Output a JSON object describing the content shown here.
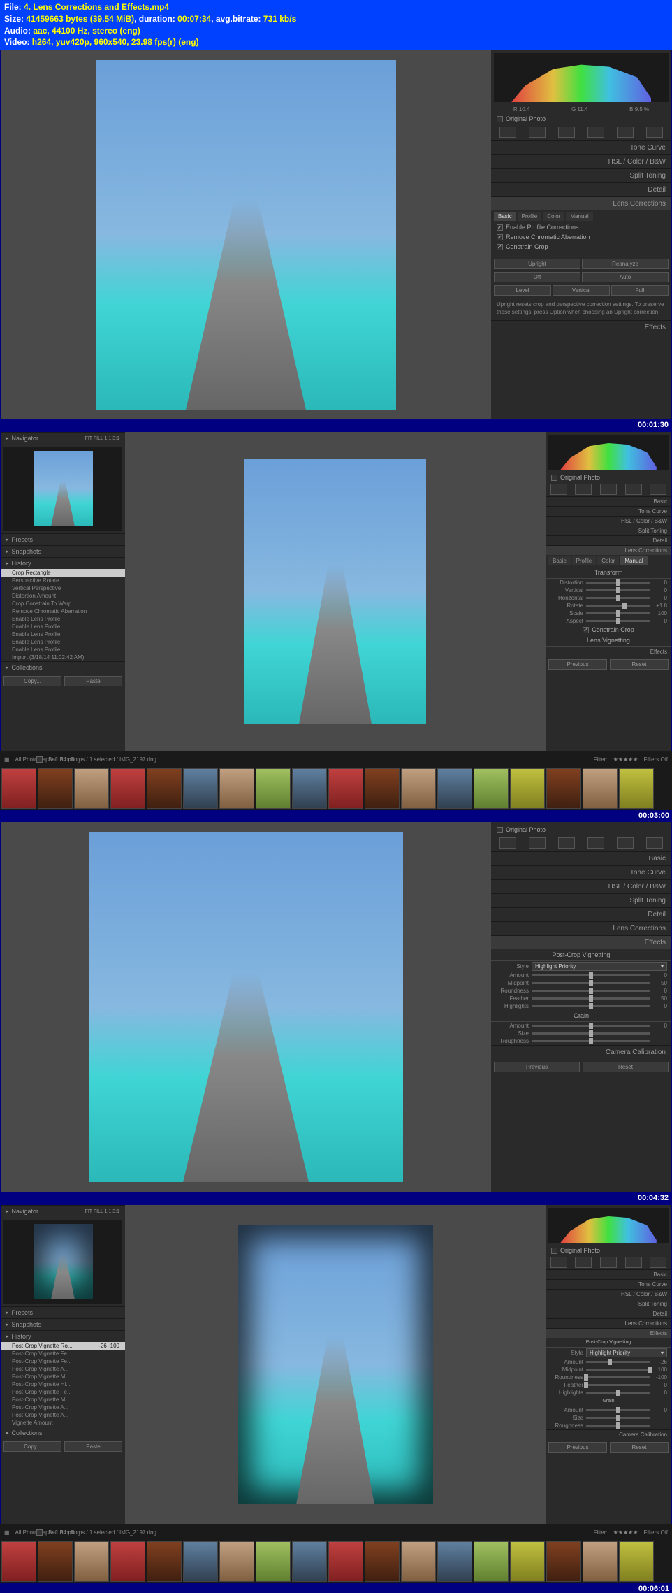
{
  "header": {
    "file_label": "File:",
    "file_value": "4. Lens Corrections and Effects.mp4",
    "size_label": "Size:",
    "size_bytes": "41459663 bytes (39.54 MiB)",
    "duration_label": "duration:",
    "duration": "00:07:34",
    "bitrate_label": "avg.bitrate:",
    "bitrate": "731 kb/s",
    "audio_label": "Audio:",
    "audio": "aac, 44100 Hz, stereo (eng)",
    "video_label": "Video:",
    "video": "h264, yuv420p, 960x540, 23.98 fps(r) (eng)"
  },
  "timestamps": [
    "00:01:30",
    "00:03:00",
    "00:04:32",
    "00:06:01"
  ],
  "panels": {
    "histogram_stats": {
      "r": "R 10.4",
      "g": "G 11.4",
      "b": "B 9.5 %"
    },
    "original_photo": "Original Photo",
    "sections": {
      "basic": "Basic",
      "tone_curve": "Tone Curve",
      "hsl": "HSL / Color / B&W",
      "split_toning": "Split Toning",
      "detail": "Detail",
      "lens_corrections": "Lens Corrections",
      "effects": "Effects",
      "camera_calibration": "Camera Calibration"
    },
    "lens_tabs": [
      "Basic",
      "Profile",
      "Color",
      "Manual"
    ],
    "lens_checks": {
      "profile": "Enable Profile Corrections",
      "chromatic": "Remove Chromatic Aberration",
      "constrain": "Constrain Crop"
    },
    "upright_btns_row1": [
      "Upright",
      "Reanalyze"
    ],
    "upright_btns_row2": [
      "Off",
      "Auto"
    ],
    "upright_btns_row3": [
      "Level",
      "Vertical",
      "Full"
    ],
    "upright_hint": "Upright resets crop and perspective correction settings. To preserve these settings, press Option when choosing an Upright correction.",
    "transform": {
      "title": "Transform",
      "rows": [
        {
          "label": "Distortion",
          "val": "0"
        },
        {
          "label": "Vertical",
          "val": "0"
        },
        {
          "label": "Horizontal",
          "val": "0"
        },
        {
          "label": "Rotate",
          "val": "+1.8"
        },
        {
          "label": "Scale",
          "val": "100"
        },
        {
          "label": "Aspect",
          "val": "0"
        }
      ],
      "constrain": "Constrain Crop",
      "lens_vignetting": "Lens Vignetting"
    },
    "effects_panel": {
      "pcv_title": "Post-Crop Vignetting",
      "style_label": "Style",
      "style_value": "Highlight Priority",
      "sliders1": [
        {
          "label": "Amount",
          "val": "0"
        },
        {
          "label": "Midpoint",
          "val": "50"
        },
        {
          "label": "Roundness",
          "val": "0"
        },
        {
          "label": "Feather",
          "val": "50"
        },
        {
          "label": "Highlights",
          "val": "0"
        }
      ],
      "grain_title": "Grain",
      "sliders2": [
        {
          "label": "Amount",
          "val": "0"
        },
        {
          "label": "Size",
          "val": ""
        },
        {
          "label": "Roughness",
          "val": ""
        }
      ]
    },
    "effects_panel_4": {
      "sliders1": [
        {
          "label": "Amount",
          "val": "-26"
        },
        {
          "label": "Midpoint",
          "val": "100"
        },
        {
          "label": "Roundness",
          "val": "-100"
        },
        {
          "label": "Feather",
          "val": "0"
        },
        {
          "label": "Highlights",
          "val": "0"
        }
      ]
    },
    "footer_btns": {
      "previous": "Previous",
      "reset": "Reset"
    }
  },
  "left": {
    "navigator": "Navigator",
    "nav_modes": "FIT  FILL  1:1  3:1",
    "presets": "Presets",
    "snapshots": "Snapshots",
    "history": "History",
    "collections": "Collections",
    "copy": "Copy...",
    "paste": "Paste",
    "history_s2": [
      {
        "label": "Crop Rectangle",
        "val": ""
      },
      {
        "label": "Perspective Rotate",
        "val": ""
      },
      {
        "label": "Vertical Perspective",
        "val": ""
      },
      {
        "label": "Distortion Amount",
        "val": ""
      },
      {
        "label": "Crop Constrain To Warp",
        "val": ""
      },
      {
        "label": "Remove Chromatic Aberration",
        "val": ""
      },
      {
        "label": "Enable Lens Profile",
        "val": ""
      },
      {
        "label": "Enable Lens Profile",
        "val": ""
      },
      {
        "label": "Enable Lens Profile",
        "val": ""
      },
      {
        "label": "Enable Lens Profile",
        "val": ""
      },
      {
        "label": "Enable Lens Profile",
        "val": ""
      },
      {
        "label": "Import (3/18/14 11:02:42 AM)",
        "val": ""
      }
    ],
    "history_s4": [
      {
        "label": "Post-Crop Vignette Ro...",
        "val": "-26   -100"
      },
      {
        "label": "Post-Crop Vignette Fe...",
        "val": ""
      },
      {
        "label": "Post-Crop Vignette Fe...",
        "val": ""
      },
      {
        "label": "Post-Crop Vignette A...",
        "val": ""
      },
      {
        "label": "Post-Crop Vignette M...",
        "val": ""
      },
      {
        "label": "Post-Crop Vignette Hi...",
        "val": ""
      },
      {
        "label": "Post-Crop Vignette Fe...",
        "val": ""
      },
      {
        "label": "Post-Crop Vignette M...",
        "val": ""
      },
      {
        "label": "Post-Crop Vignette A...",
        "val": ""
      },
      {
        "label": "Post-Crop Vignette A...",
        "val": ""
      },
      {
        "label": "Vignette Amount",
        "val": ""
      }
    ]
  },
  "toolbar": {
    "all_photos": "All Photographs",
    "selection": "34 photos / 1 selected / IMG_2197.dng",
    "soft_proof": "Soft Proofing",
    "filter": "Filter:",
    "filters_off": "Filters Off"
  }
}
